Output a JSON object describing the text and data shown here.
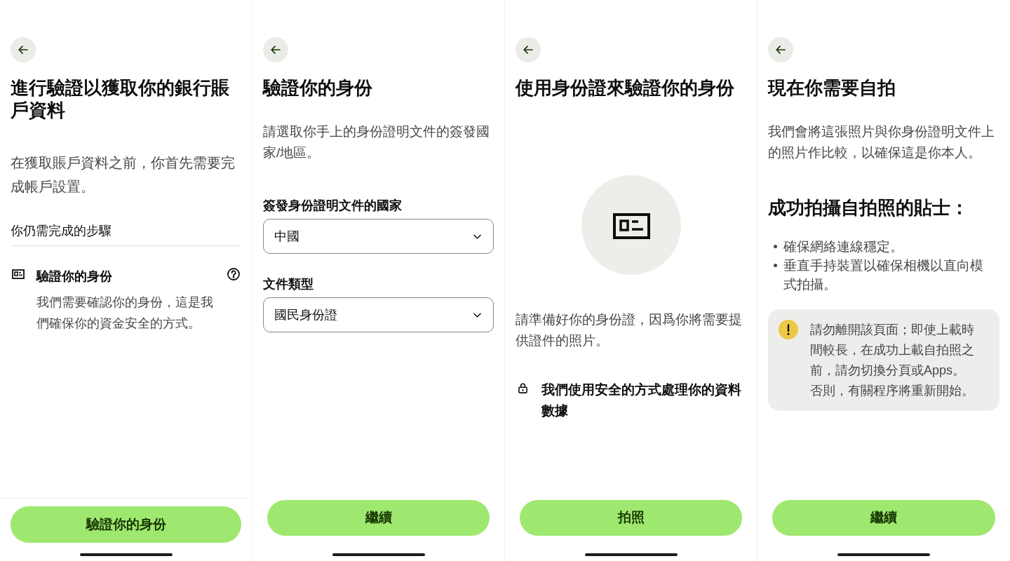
{
  "screens": [
    {
      "kind": "steps",
      "title": "進行驗證以獲取你的銀行賬戶資料",
      "intro": "在獲取賬戶資料之前，你首先需要完成帳戶設置。",
      "section_heading": "你仍需完成的步驟",
      "steps": [
        {
          "title": "驗證你的身份",
          "description": "我們需要確認你的身份，這是我們確保你的資金安全的方式。"
        }
      ],
      "button": "驗證你的身份"
    },
    {
      "kind": "form",
      "title": "驗證你的身份",
      "intro": "請選取你手上的身份證明文件的簽發國家/地區。",
      "fields": [
        {
          "label": "簽發身份證明文件的國家",
          "value": "中國"
        },
        {
          "label": "文件類型",
          "value": "國民身份證"
        }
      ],
      "button": "繼續"
    },
    {
      "kind": "document",
      "title": "使用身份證來驗證你的身份",
      "intro": "請準備好你的身份證，因爲你將需要提供證件的照片。",
      "note": "我們使用安全的方式處理你的資料數據",
      "button": "拍照"
    },
    {
      "kind": "selfie",
      "title": "現在你需要自拍",
      "intro": "我們會將這張照片與你身份證明文件上的照片作比較，以確保這是你本人。",
      "tips_heading": "成功拍攝自拍照的貼士：",
      "tips": [
        "確保網絡連線穩定。",
        "垂直手持裝置以確保相機以直向模式拍攝。"
      ],
      "warning": "請勿離開該頁面；即使上載時間較長，在成功上載自拍照之前，請勿切換分頁或Apps。否則，有關程序將重新開始。",
      "button": "繼續"
    }
  ]
}
